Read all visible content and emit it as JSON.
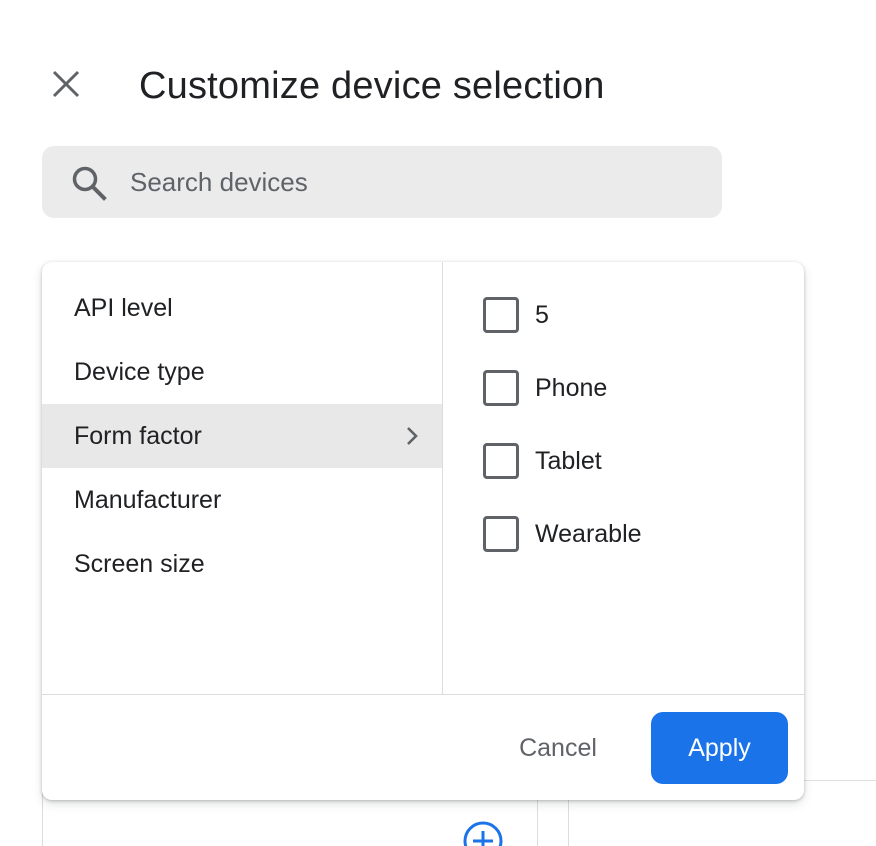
{
  "header": {
    "title": "Customize device selection",
    "close_icon": "close-icon"
  },
  "search": {
    "placeholder": "Search devices",
    "value": "",
    "icon": "search-icon"
  },
  "filters": {
    "categories": [
      {
        "label": "API level",
        "selected": false
      },
      {
        "label": "Device type",
        "selected": false
      },
      {
        "label": "Form factor",
        "selected": true
      },
      {
        "label": "Manufacturer",
        "selected": false
      },
      {
        "label": "Screen size",
        "selected": false
      }
    ],
    "options": [
      {
        "label": "5",
        "checked": false
      },
      {
        "label": "Phone",
        "checked": false
      },
      {
        "label": "Tablet",
        "checked": false
      },
      {
        "label": "Wearable",
        "checked": false
      }
    ]
  },
  "actions": {
    "cancel_label": "Cancel",
    "apply_label": "Apply"
  },
  "colors": {
    "primary": "#1a73e8",
    "text": "#202124",
    "secondary_text": "#5f6368",
    "search_bg": "#ebebeb",
    "selected_bg": "#e8e8e8"
  }
}
